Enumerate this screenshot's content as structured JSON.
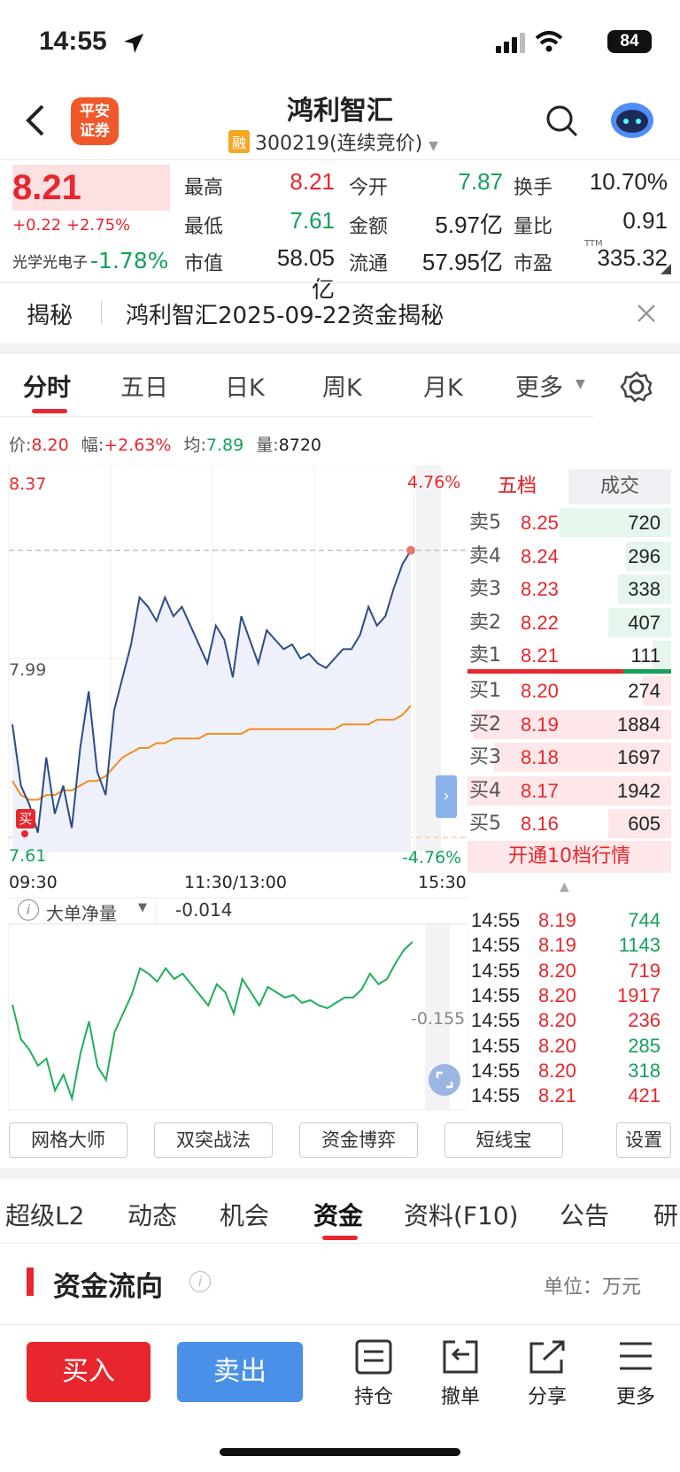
{
  "status_bar": {
    "time": "14:55",
    "battery": "84"
  },
  "header": {
    "title": "鸿利智汇",
    "rong_badge": "融",
    "code": "300219(连续竞价)",
    "logo_line1": "平安",
    "logo_line2": "证券"
  },
  "quote": {
    "price": "8.21",
    "change": "+0.22 +2.75%",
    "sector_name": "光学光电子",
    "sector_change": "-1.78%",
    "fields": [
      {
        "label": "最高",
        "value": "8.21"
      },
      {
        "label": "今开",
        "value": "7.87"
      },
      {
        "label": "换手",
        "value": "10.70%"
      },
      {
        "label": "最低",
        "value": "7.61"
      },
      {
        "label": "金额",
        "value": "5.97亿"
      },
      {
        "label": "量比",
        "value": "0.91"
      },
      {
        "label": "市值",
        "value": "58.05亿"
      },
      {
        "label": "流通",
        "value": "57.95亿"
      },
      {
        "label": "市盈",
        "value": "335.32"
      }
    ],
    "pe_sup": "TTM"
  },
  "reveal": {
    "label": "揭秘",
    "text": "鸿利智汇2025-09-22资金揭秘"
  },
  "chart_tabs": [
    "分时",
    "五日",
    "日K",
    "周K",
    "月K",
    "更多"
  ],
  "info_line": {
    "price_label": "价:",
    "price": "8.20",
    "amp_label": "幅:",
    "amp": "+2.63%",
    "avg_label": "均:",
    "avg": "7.89",
    "vol_label": "量:",
    "vol": "8720"
  },
  "chart_data": {
    "type": "line",
    "y_top": "8.37",
    "y_mid": "7.99",
    "y_bottom": "7.61",
    "pct_top": "4.76%",
    "pct_bottom": "-4.76%",
    "x_labels": [
      "09:30",
      "11:30/13:00",
      "15:30"
    ],
    "ylim": [
      7.61,
      8.37
    ],
    "series": [
      {
        "values": [
          7.85,
          7.72,
          7.68,
          7.62,
          7.78,
          7.66,
          7.72,
          7.63,
          7.8,
          7.92,
          7.75,
          7.7,
          7.88,
          7.95,
          8.02,
          8.12,
          8.1,
          8.07,
          8.12,
          8.08,
          8.1,
          8.06,
          8.02,
          7.98,
          8.06,
          8.03,
          7.95,
          8.08,
          8.03,
          7.98,
          8.05,
          8.03,
          8.01,
          8.02,
          7.99,
          8.0,
          7.98,
          7.97,
          7.99,
          8.01,
          8.01,
          8.04,
          8.1,
          8.06,
          8.08,
          8.14,
          8.19,
          8.22
        ]
      },
      {
        "values": [
          7.73,
          7.7,
          7.69,
          7.69,
          7.7,
          7.7,
          7.71,
          7.71,
          7.72,
          7.73,
          7.73,
          7.74,
          7.76,
          7.78,
          7.79,
          7.8,
          7.8,
          7.81,
          7.81,
          7.82,
          7.82,
          7.82,
          7.82,
          7.83,
          7.83,
          7.83,
          7.83,
          7.83,
          7.84,
          7.84,
          7.84,
          7.84,
          7.84,
          7.84,
          7.84,
          7.84,
          7.84,
          7.84,
          7.84,
          7.85,
          7.85,
          7.85,
          7.85,
          7.86,
          7.86,
          7.86,
          7.87,
          7.89
        ]
      }
    ]
  },
  "orderbook": {
    "tabs": [
      "五档",
      "成交"
    ],
    "asks": [
      {
        "label": "卖5",
        "price": "8.25",
        "vol": "720",
        "fill": 0.55
      },
      {
        "label": "卖4",
        "price": "8.24",
        "vol": "296",
        "fill": 0.22
      },
      {
        "label": "卖3",
        "price": "8.23",
        "vol": "338",
        "fill": 0.26
      },
      {
        "label": "卖2",
        "price": "8.22",
        "vol": "407",
        "fill": 0.31
      },
      {
        "label": "卖1",
        "price": "8.21",
        "vol": "111",
        "fill": 0.09
      }
    ],
    "bids": [
      {
        "label": "买1",
        "price": "8.20",
        "vol": "274",
        "fill": 0.14
      },
      {
        "label": "买2",
        "price": "8.19",
        "vol": "1884",
        "fill": 0.97
      },
      {
        "label": "买3",
        "price": "8.18",
        "vol": "1697",
        "fill": 0.87
      },
      {
        "label": "买4",
        "price": "8.17",
        "vol": "1942",
        "fill": 1.0
      },
      {
        "label": "买5",
        "price": "8.16",
        "vol": "605",
        "fill": 0.31
      }
    ],
    "upgrade": "开通10档行情"
  },
  "trades": [
    {
      "time": "14:55",
      "price": "8.19",
      "vol": "744",
      "color": "green"
    },
    {
      "time": "14:55",
      "price": "8.19",
      "vol": "1143",
      "color": "green"
    },
    {
      "time": "14:55",
      "price": "8.20",
      "vol": "719",
      "color": "red"
    },
    {
      "time": "14:55",
      "price": "8.20",
      "vol": "1917",
      "color": "red"
    },
    {
      "time": "14:55",
      "price": "8.20",
      "vol": "236",
      "color": "red"
    },
    {
      "time": "14:55",
      "price": "8.20",
      "vol": "285",
      "color": "green"
    },
    {
      "time": "14:55",
      "price": "8.20",
      "vol": "318",
      "color": "green"
    },
    {
      "time": "14:55",
      "price": "8.21",
      "vol": "421",
      "color": "red"
    }
  ],
  "sub_chart": {
    "label": "大单净量",
    "value": "-0.014",
    "axis_label": "-0.155",
    "buy_marker": "买"
  },
  "tools": [
    "网格大师",
    "双突战法",
    "资金博弈",
    "短线宝",
    "设置"
  ],
  "bottom_tabs": [
    "超级L2",
    "动态",
    "机会",
    "资金",
    "资料(F10)",
    "公告",
    "研"
  ],
  "fund_flow": {
    "title": "资金流向",
    "unit": "单位：万元"
  },
  "action_bar": {
    "buy": "买入",
    "sell": "卖出",
    "items": [
      "持仓",
      "撤单",
      "分享",
      "更多"
    ]
  }
}
